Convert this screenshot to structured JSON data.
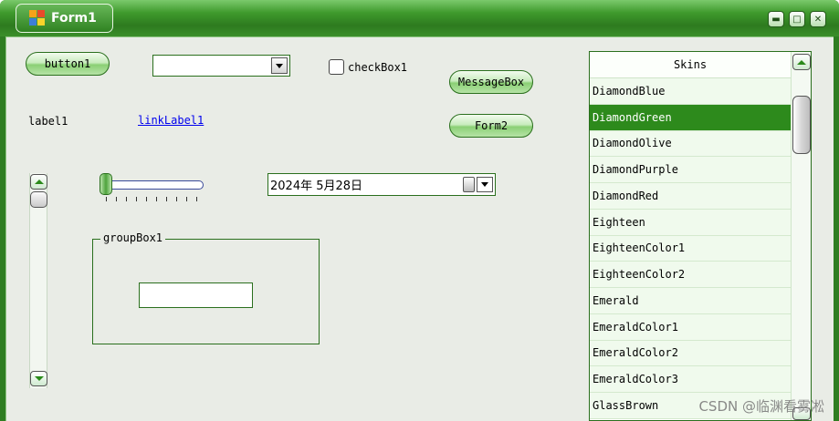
{
  "window": {
    "title": "Form1",
    "accent_color": "#2f7d22",
    "controls": [
      "minimize-icon",
      "maximize-icon",
      "close-icon"
    ],
    "icons": {
      "minimize": "▬",
      "maximize": "□",
      "close": "✕"
    }
  },
  "button1": {
    "label": "button1"
  },
  "combobox": {
    "value": ""
  },
  "checkbox": {
    "label": "checkBox1",
    "checked": false
  },
  "messagebox_button": {
    "label": "MessageBox"
  },
  "form2_button": {
    "label": "Form2"
  },
  "label1": {
    "text": "label1"
  },
  "linklabel": {
    "text": "linkLabel1"
  },
  "trackbar": {
    "value_fraction": 0.05
  },
  "date_picker": {
    "value": "2024年  5月28日"
  },
  "groupbox": {
    "caption": "groupBox1",
    "textbox_value": ""
  },
  "skins_list": {
    "header": "Skins",
    "selected_color": "#2d8a1c",
    "items": [
      {
        "label": "DiamondBlue"
      },
      {
        "label": "DiamondGreen",
        "selected": true
      },
      {
        "label": "DiamondOlive"
      },
      {
        "label": "DiamondPurple"
      },
      {
        "label": "DiamondRed"
      },
      {
        "label": "Eighteen"
      },
      {
        "label": "EighteenColor1"
      },
      {
        "label": "EighteenColor2"
      },
      {
        "label": "Emerald"
      },
      {
        "label": "EmeraldColor1"
      },
      {
        "label": "EmeraldColor2"
      },
      {
        "label": "EmeraldColor3"
      },
      {
        "label": "GlassBrown"
      }
    ]
  },
  "watermark": {
    "text": "CSDN @临渊看雾凇"
  }
}
